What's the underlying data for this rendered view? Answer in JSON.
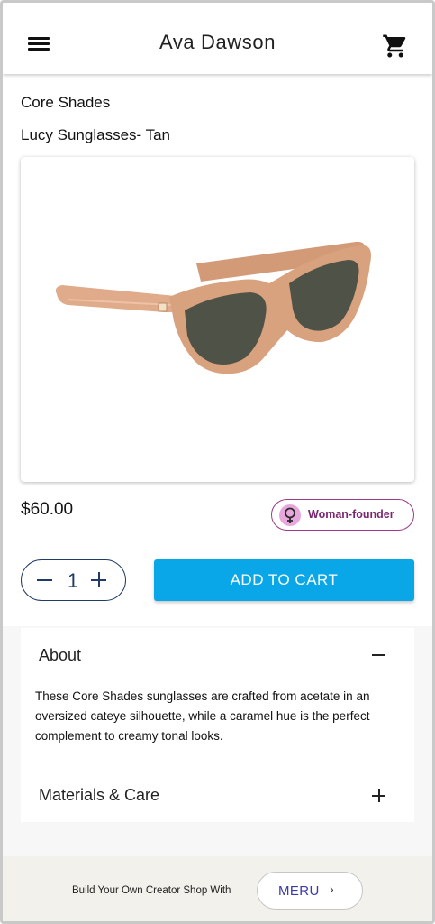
{
  "header": {
    "title": "Ava Dawson",
    "menu_icon": "hamburger-menu-icon",
    "cart_icon": "shopping-cart-icon"
  },
  "product": {
    "shop_name": "Core Shades",
    "title": "Lucy Sunglasses- Tan",
    "price": "$60.00",
    "badge_label": "Woman-founder",
    "badge_icon": "female-symbol-icon",
    "image_colors": {
      "frame": "#d9a27f",
      "lens": "#4f5347"
    }
  },
  "quantity": {
    "value": "1"
  },
  "cart": {
    "add_label": "ADD TO CART",
    "accent": "#0aa7e8"
  },
  "accordion": {
    "about_title": "About",
    "about_text": "These Core Shades sunglasses are crafted from acetate in an oversized cateye silhouette, while a caramel hue is the perfect complement to creamy tonal looks.",
    "materials_title": "Materials & Care"
  },
  "footer": {
    "text": "Build Your Own Creator Shop With",
    "brand_button": "MERU",
    "chevron": "›"
  }
}
